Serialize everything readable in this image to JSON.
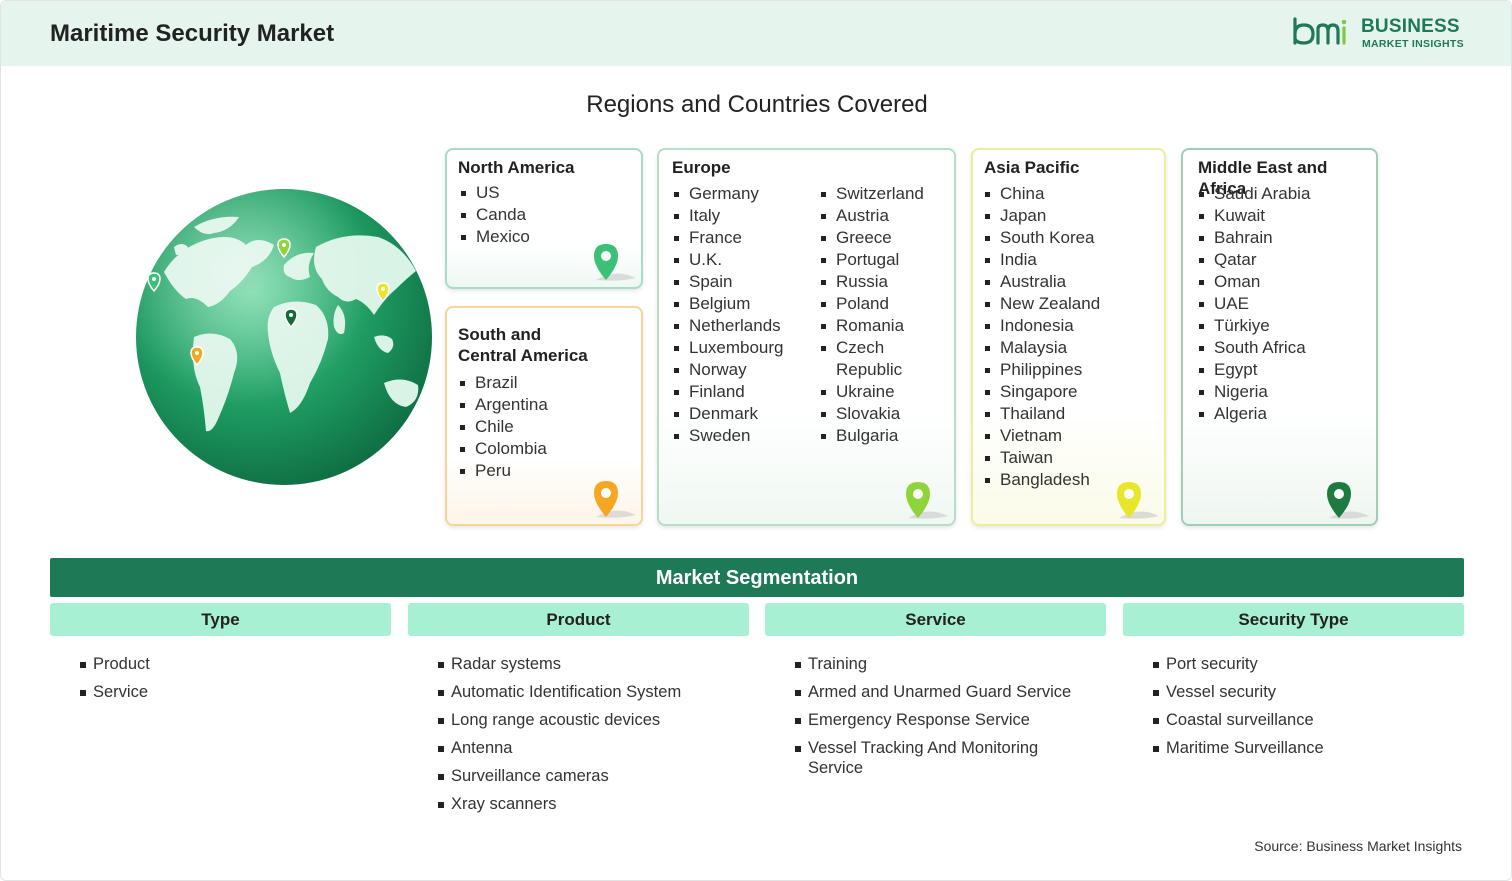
{
  "header": {
    "title": "Maritime Security Market",
    "logo": {
      "mark": "bmi",
      "line1": "BUSINESS",
      "line2": "MARKET INSIGHTS"
    }
  },
  "regions_section": {
    "title": "Regions and Countries Covered",
    "regions": [
      {
        "name": "North America",
        "pin_color": "#3cbf77",
        "countries": [
          "US",
          "Canda",
          "Mexico"
        ]
      },
      {
        "name_line1": "South and",
        "name_line2": "Central America",
        "pin_color": "#f5a623",
        "countries": [
          "Brazil",
          "Argentina",
          "Chile",
          "Colombia",
          "Peru"
        ]
      },
      {
        "name": "Europe",
        "pin_color": "#8fd43b",
        "countries_col1": [
          "Germany",
          "Italy",
          "France",
          "U.K.",
          "Spain",
          "Belgium",
          "Netherlands",
          "Luxembourg",
          "Norway",
          "Finland",
          "Denmark",
          "Sweden"
        ],
        "countries_col2": [
          "Switzerland",
          "Austria",
          "Greece",
          "Portugal",
          "Russia",
          "Poland",
          "Romania",
          "Czech Republic",
          "Ukraine",
          "Slovakia",
          "Bulgaria"
        ]
      },
      {
        "name": "Asia Pacific",
        "pin_color": "#e8e62a",
        "countries": [
          "China",
          "Japan",
          "South Korea",
          "India",
          "Australia",
          "New Zealand",
          "Indonesia",
          "Malaysia",
          "Philippines",
          "Singapore",
          "Thailand",
          "Vietnam",
          "Taiwan",
          "Bangladesh"
        ]
      },
      {
        "name": "Middle East and Africa",
        "pin_color": "#1e7a3e",
        "countries": [
          "Saudi Arabia",
          "Kuwait",
          "Bahrain",
          "Qatar",
          "Oman",
          "UAE",
          "Türkiye",
          "South Africa",
          "Egypt",
          "Nigeria",
          "Algeria"
        ]
      }
    ]
  },
  "segmentation": {
    "title": "Market Segmentation",
    "columns": [
      {
        "heading": "Type",
        "items": [
          "Product",
          "Service"
        ]
      },
      {
        "heading": "Product",
        "items": [
          "Radar systems",
          "Automatic Identification System",
          "Long range acoustic devices",
          "Antenna",
          "Surveillance cameras",
          "Xray scanners"
        ]
      },
      {
        "heading": "Service",
        "items": [
          "Training",
          "Armed and Unarmed Guard Service",
          "Emergency Response Service",
          "Vessel Tracking And Monitoring Service"
        ]
      },
      {
        "heading": "Security Type",
        "items": [
          "Port security",
          "Vessel security",
          "Coastal surveillance",
          "Maritime Surveillance"
        ]
      }
    ]
  },
  "footer": {
    "source": "Source: Business Market Insights"
  },
  "colors": {
    "brand": "#1e7a56",
    "header_bg": "#e6f4ee",
    "segment_head_bg": "#a8f0d4"
  }
}
